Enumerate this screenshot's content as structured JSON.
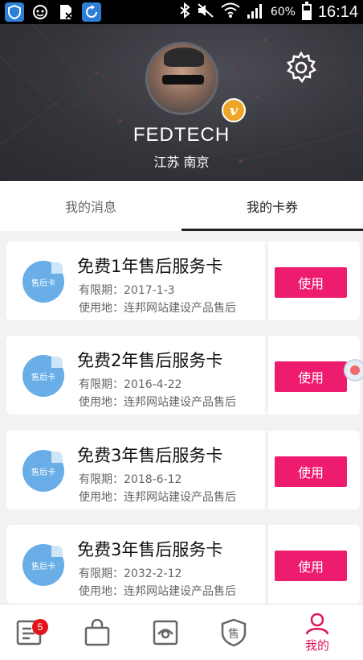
{
  "status_bar": {
    "battery_percent": "60%",
    "battery_level": 0.6,
    "time": "16:14",
    "icons": [
      "shield-icon",
      "face-icon",
      "no-sim-icon",
      "sync-icon",
      "bluetooth-icon",
      "mute-icon",
      "wifi-icon",
      "signal-icon",
      "battery-icon"
    ]
  },
  "profile": {
    "username": "FEDTECH",
    "location": "江苏 南京",
    "vip_badge": "v",
    "settings_icon": "gear-icon"
  },
  "tabs": [
    {
      "label": "我的消息",
      "active": false
    },
    {
      "label": "我的卡券",
      "active": true
    }
  ],
  "coupons": [
    {
      "sticker": "售后卡",
      "title": "免费1年售后服务卡",
      "expiry": "有限期：2017-1-3",
      "place": "使用地：连邦网站建设产品售后",
      "button": "使用"
    },
    {
      "sticker": "售后卡",
      "title": "免费2年售后服务卡",
      "expiry": "有限期：2016-4-22",
      "place": "使用地：连邦网站建设产品售后",
      "button": "使用"
    },
    {
      "sticker": "售后卡",
      "title": "免费3年售后服务卡",
      "expiry": "有限期：2018-6-12",
      "place": "使用地：连邦网站建设产品售后",
      "button": "使用"
    },
    {
      "sticker": "售后卡",
      "title": "免费3年售后服务卡",
      "expiry": "有限期：2032-2-12",
      "place": "使用地：连邦网站建设产品售后",
      "button": "使用"
    }
  ],
  "bottom_nav": {
    "items": [
      {
        "icon": "document-list-icon",
        "badge": "5",
        "label": ""
      },
      {
        "icon": "shopping-bag-icon",
        "label": ""
      },
      {
        "icon": "eye-window-icon",
        "label": ""
      },
      {
        "icon": "after-sales-shield-icon",
        "glyph": "售",
        "label": ""
      },
      {
        "icon": "person-icon",
        "label": "我的"
      }
    ]
  },
  "colors": {
    "accent": "#ee1c6e",
    "header_bg": "#34343b",
    "sticker": "#6aaee8",
    "badge": "#e3141b"
  }
}
